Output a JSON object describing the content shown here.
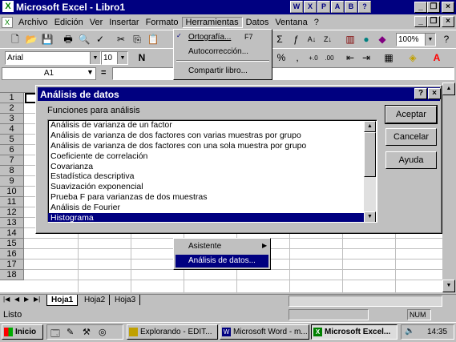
{
  "window": {
    "title": "Microsoft Excel - Libro1"
  },
  "menubar": {
    "items": [
      "Archivo",
      "Edición",
      "Ver",
      "Insertar",
      "Formato",
      "Herramientas",
      "Datos",
      "Ventana",
      "?"
    ]
  },
  "tools_menu": {
    "items": [
      {
        "label": "Ortografía...",
        "shortcut": "F7"
      },
      {
        "label": "Autocorrección..."
      },
      {
        "label": "Compartir libro..."
      }
    ]
  },
  "format_bar": {
    "font": "Arial",
    "size": "10",
    "zoom": "100%"
  },
  "formula_bar": {
    "cell_ref": "A1",
    "equals": "="
  },
  "sheet": {
    "rows": [
      "1",
      "2",
      "3",
      "4",
      "5",
      "6",
      "7",
      "8",
      "9",
      "10",
      "11",
      "12",
      "13",
      "14",
      "15",
      "16",
      "17",
      "18"
    ]
  },
  "dialog": {
    "title": "Análisis de datos",
    "help": "?",
    "list_label": "Funciones para análisis",
    "items": [
      "Análisis de varianza de un factor",
      "Análisis de varianza de dos factores con varias muestras por grupo",
      "Análisis de varianza de dos factores con una sola muestra por grupo",
      "Coeficiente de correlación",
      "Covarianza",
      "Estadística descriptiva",
      "Suavización exponencial",
      "Prueba F para varianzas de dos muestras",
      "Análisis de Fourier",
      "Histograma"
    ],
    "selected_index": 9,
    "buttons": {
      "ok": "Aceptar",
      "cancel": "Cancelar",
      "help": "Ayuda"
    }
  },
  "submenu": {
    "items": [
      "Asistente",
      "Análisis de datos..."
    ]
  },
  "sheet_tabs": [
    "Hoja1",
    "Hoja2",
    "Hoja3"
  ],
  "status": {
    "text": "Listo",
    "indicator": "NUM"
  },
  "taskbar": {
    "start": "Inicio",
    "tasks": [
      "Explorando - EDIT...",
      "Microsoft Word - m...",
      "Microsoft Excel..."
    ],
    "clock": "14:35"
  }
}
